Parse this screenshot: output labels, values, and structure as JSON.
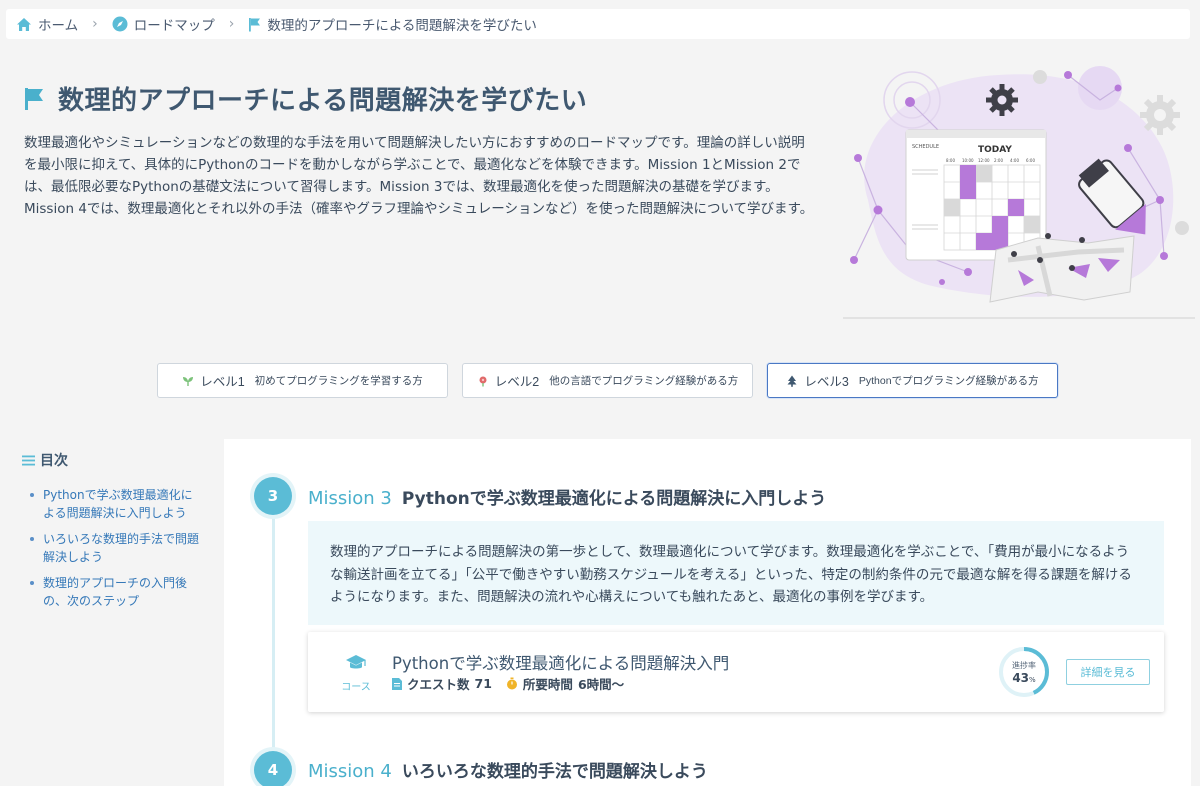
{
  "breadcrumb": {
    "home": "ホーム",
    "roadmap": "ロードマップ",
    "current": "数理的アプローチによる問題解決を学びたい"
  },
  "hero": {
    "title": "数理的アプローチによる問題解決を学びたい",
    "description": "数理最適化やシミュレーションなどの数理的な手法を用いて問題解決したい方におすすめのロードマップです。理論の詳しい説明を最小限に抑えて、具体的にPythonのコードを動かしながら学ぶことで、最適化などを体験できます。Mission 1とMission 2では、最低限必要なPythonの基礎文法について習得します。Mission 3では、数理最適化を使った問題解決の基礎を学びます。Mission 4では、数理最適化とそれ以外の手法（確率やグラフ理論やシミュレーションなど）を使った問題解決について学びます。",
    "illustration": {
      "schedule_label": "SCHEDULE",
      "today_label": "TODAY",
      "times": [
        "8:00",
        "10:00",
        "12:00",
        "2:00",
        "4:00",
        "6:00"
      ]
    }
  },
  "levels": [
    {
      "name": "レベル1",
      "desc": "初めてプログラミングを学習する方",
      "icon": "sprout-icon",
      "color": "#7cc27a"
    },
    {
      "name": "レベル2",
      "desc": "他の言語でプログラミング経験がある方",
      "icon": "flower-icon",
      "color": "#e06a6a"
    },
    {
      "name": "レベル3",
      "desc": "Pythonでプログラミング経験がある方",
      "icon": "tree-icon",
      "color": "#3f5870",
      "active": true
    }
  ],
  "toc": {
    "title": "目次",
    "items": [
      "Pythonで学ぶ数理最適化による問題解決に入門しよう",
      "いろいろな数理的手法で問題解決しよう",
      "数理的アプローチの入門後の、次のステップ"
    ]
  },
  "missions": [
    {
      "number": "3",
      "label": "Mission 3",
      "title": "Pythonで学ぶ数理最適化による問題解決に入門しよう",
      "description": "数理的アプローチによる問題解決の第一歩として、数理最適化について学びます。数理最適化を学ぶことで、「費用が最小になるような輸送計画を立てる」「公平で働きやすい勤務スケジュールを考える」といった、特定の制約条件の元で最適な解を得る課題を解けるようになります。また、問題解決の流れや心構えについても触れたあと、最適化の事例を学びます。",
      "course": {
        "type_label": "コース",
        "title": "Pythonで学ぶ数理最適化による問題解決入門",
        "quest_label": "クエスト数",
        "quest_count": "71",
        "time_label": "所要時間",
        "time_value": "6時間〜",
        "progress_label": "進捗率",
        "progress_value": "43",
        "progress_unit": "%",
        "progress_fraction": 0.43,
        "detail_button": "詳細を見る"
      }
    },
    {
      "number": "4",
      "label": "Mission 4",
      "title": "いろいろな数理的手法で問題解決しよう"
    }
  ],
  "colors": {
    "accent": "#5bbcd6",
    "link": "#3578b8",
    "title": "#3f5870",
    "illustration_purple": "#b679d9"
  }
}
